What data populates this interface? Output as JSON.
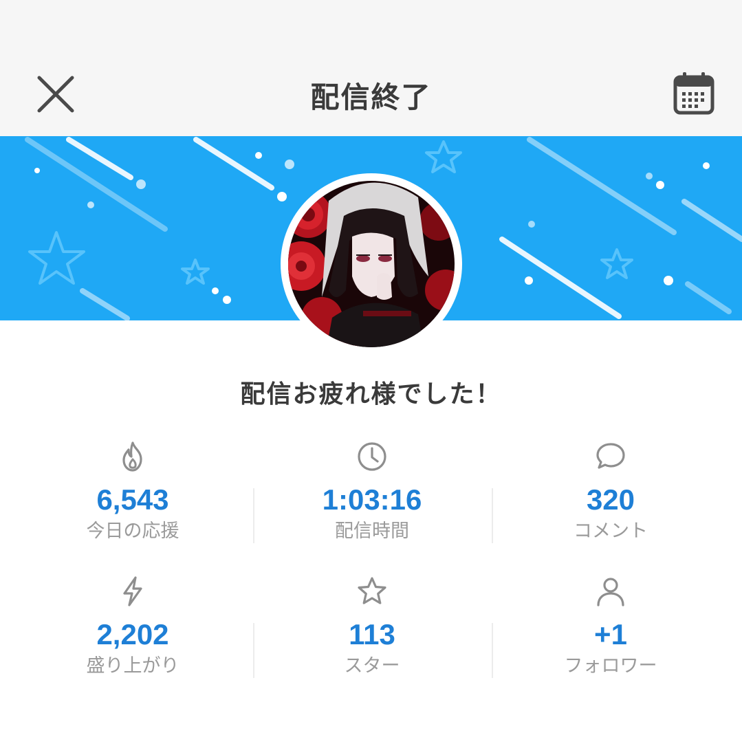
{
  "header": {
    "title": "配信終了",
    "close_icon": "close-icon",
    "calendar_icon": "calendar-icon"
  },
  "banner": {
    "background_color": "#1fa8f5"
  },
  "message": "配信お疲れ様でした！",
  "stats": [
    {
      "icon": "flame-icon",
      "value": "6,543",
      "label": "今日の応援"
    },
    {
      "icon": "clock-icon",
      "value": "1:03:16",
      "label": "配信時間"
    },
    {
      "icon": "comment-icon",
      "value": "320",
      "label": "コメント"
    },
    {
      "icon": "lightning-icon",
      "value": "2,202",
      "label": "盛り上がり"
    },
    {
      "icon": "star-icon",
      "value": "113",
      "label": "スター"
    },
    {
      "icon": "person-icon",
      "value": "+1",
      "label": "フォロワー"
    }
  ],
  "colors": {
    "accent": "#1e7fd6",
    "label": "#9a9a9a",
    "title": "#3a3a3a"
  }
}
